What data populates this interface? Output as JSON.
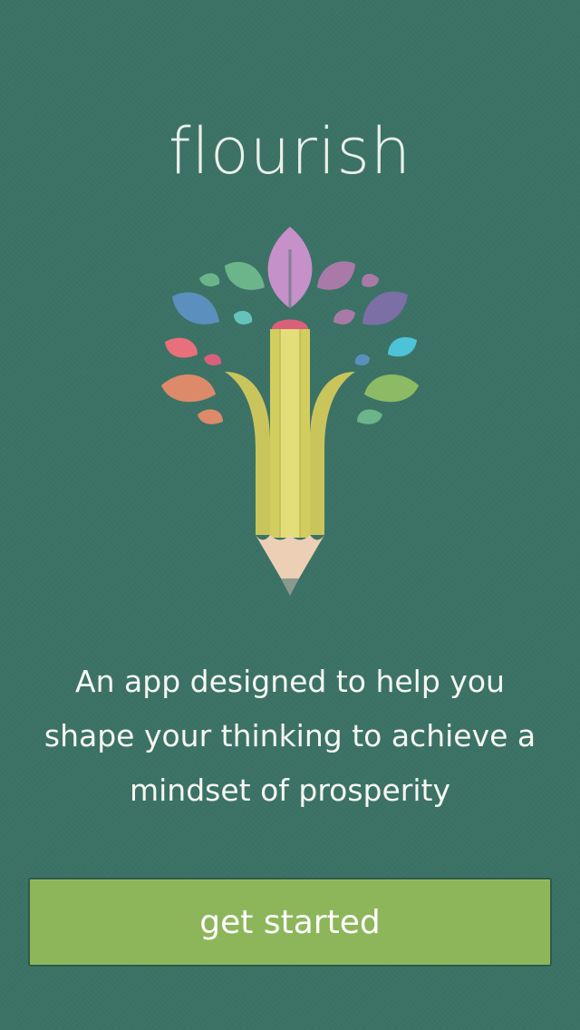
{
  "app": {
    "title": "flourish"
  },
  "hero": {
    "logo_icon": "pencil-tree-icon",
    "leaf_colors": [
      "#c690c8",
      "#6cb48a",
      "#a97aa8",
      "#5b8fbd",
      "#7b6fa6",
      "#e8707c",
      "#4ec2d6",
      "#dd8a6a",
      "#8dba64",
      "#66c3b9"
    ],
    "pencil_color": "#e3de7a",
    "eraser_color": "#d9607a"
  },
  "intro": {
    "tagline_lines": [
      "An app designed to help you",
      "shape your thinking to achieve a",
      "mindset of prosperity"
    ]
  },
  "actions": {
    "get_started_label": "get started",
    "button_color": "#8db65b"
  }
}
